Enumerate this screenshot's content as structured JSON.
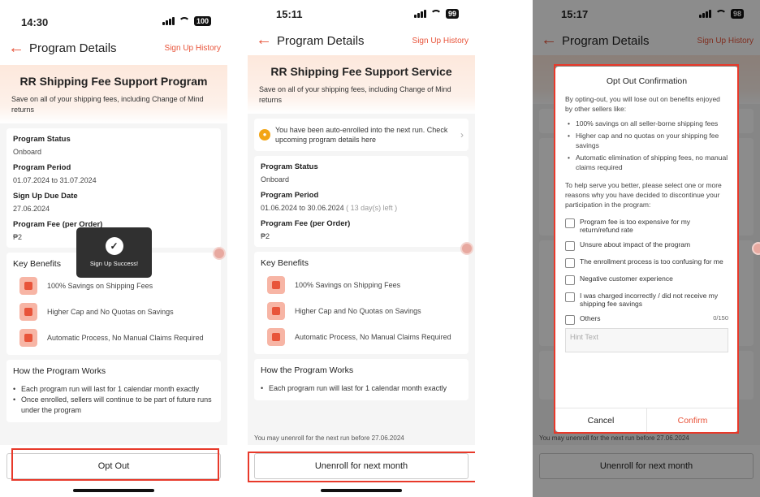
{
  "phone1": {
    "time": "14:30",
    "battery": "100",
    "nav_title": "Program Details",
    "history": "Sign Up History",
    "hero_title": "RR Shipping Fee Support Program",
    "hero_sub": "Save on all of your shipping fees, including Change of Mind returns",
    "status_label": "Program Status",
    "status_value": "Onboard",
    "period_label": "Program Period",
    "period_value": "01.07.2024 to 31.07.2024",
    "due_label": "Sign Up Due Date",
    "due_value": "27.06.2024",
    "fee_label": "Program Fee (per Order)",
    "fee_value": "₱2",
    "toast": "Sign Up Success!",
    "benefits_title": "Key Benefits",
    "benefits": [
      "100% Savings on Shipping Fees",
      "Higher Cap and No Quotas on Savings",
      "Automatic Process, No Manual Claims Required"
    ],
    "how_title": "How the Program Works",
    "how": [
      "Each program run will last for 1 calendar month exactly",
      "Once enrolled, sellers will continue to be part of future runs under the program"
    ],
    "button": "Opt Out"
  },
  "phone2": {
    "time": "15:11",
    "battery": "99",
    "nav_title": "Program Details",
    "history": "Sign Up History",
    "hero_title": "RR Shipping Fee Support Service",
    "hero_sub": "Save on all of your shipping fees, including Change of Mind returns",
    "notice": "You have been auto-enrolled into the next run. Check upcoming program details here",
    "status_label": "Program Status",
    "status_value": "Onboard",
    "period_label": "Program Period",
    "period_value": "01.06.2024 to 30.06.2024",
    "period_left": "( 13 day(s) left )",
    "fee_label": "Program Fee (per Order)",
    "fee_value": "₱2",
    "benefits_title": "Key Benefits",
    "benefits": [
      "100% Savings on Shipping Fees",
      "Higher Cap and No Quotas on Savings",
      "Automatic Process, No Manual Claims Required"
    ],
    "how_title": "How the Program Works",
    "how": [
      "Each program run will last for 1 calendar month exactly"
    ],
    "unenroll_note": "You may unenroll for the next run before 27.06.2024",
    "button": "Unenroll for next month"
  },
  "phone3": {
    "time": "15:17",
    "battery": "98",
    "nav_title": "Program Details",
    "history": "Sign Up History",
    "unenroll_note": "You may unenroll for the next run before 27.06.2024",
    "button": "Unenroll for next month",
    "modal": {
      "title": "Opt Out Confirmation",
      "intro": "By opting-out, you will lose out on benefits enjoyed by other sellers like:",
      "benefits": [
        "100% savings on all seller-borne shipping fees",
        "Higher cap and no quotas on your shipping fee savings",
        "Automatic elimination of shipping fees, no manual claims required"
      ],
      "reasons_prompt": "To help serve you better, please select one or more reasons why you have decided to discontinue your participation in the program:",
      "options": [
        "Program fee is too expensive for my return/refund rate",
        "Unsure about impact of the program",
        "The enrollment process is too confusing for me",
        "Negative customer experience",
        "I was charged incorrectly / did not receive my shipping fee savings",
        "Others"
      ],
      "counter": "0/150",
      "hint": "Hint Text",
      "cancel": "Cancel",
      "confirm": "Confirm"
    }
  },
  "colors": {
    "accent": "#e8543a",
    "highlight": "#e8392a"
  }
}
